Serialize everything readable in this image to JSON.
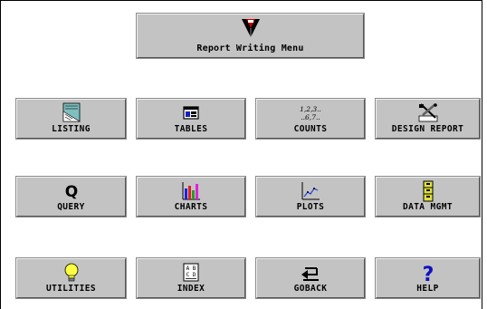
{
  "title_button": {
    "label": "Report Writing Menu",
    "icon": "report-logo-icon"
  },
  "buttons": [
    {
      "id": "listing",
      "label": "LISTING",
      "icon": "listing-icon"
    },
    {
      "id": "tables",
      "label": "TABLES",
      "icon": "tables-icon"
    },
    {
      "id": "counts",
      "label": "COUNTS",
      "icon": "counts-icon"
    },
    {
      "id": "design-report",
      "label": "DESIGN REPORT",
      "icon": "design-report-icon"
    },
    {
      "id": "query",
      "label": "QUERY",
      "icon": "query-icon"
    },
    {
      "id": "charts",
      "label": "CHARTS",
      "icon": "charts-icon"
    },
    {
      "id": "plots",
      "label": "PLOTS",
      "icon": "plots-icon"
    },
    {
      "id": "data-mgmt",
      "label": "DATA MGMT",
      "icon": "data-mgmt-icon"
    },
    {
      "id": "utilities",
      "label": "UTILITIES",
      "icon": "lightbulb-icon"
    },
    {
      "id": "index",
      "label": "INDEX",
      "icon": "index-icon"
    },
    {
      "id": "goback",
      "label": "GOBACK",
      "icon": "goback-icon"
    },
    {
      "id": "help",
      "label": "HELP",
      "icon": "help-icon"
    }
  ],
  "counts_icon_text": {
    "line1": "1,2,3..",
    "line2": "..6,7.."
  },
  "index_icon_text": {
    "line1": "A B",
    "line2": "C D"
  },
  "query_icon_text": "Q",
  "help_icon_text": "?",
  "colors": {
    "button_face": "#c3c3c3",
    "help_blue": "#1010c0",
    "bulb_yellow": "#ffff40",
    "frame_border": "#000000"
  }
}
